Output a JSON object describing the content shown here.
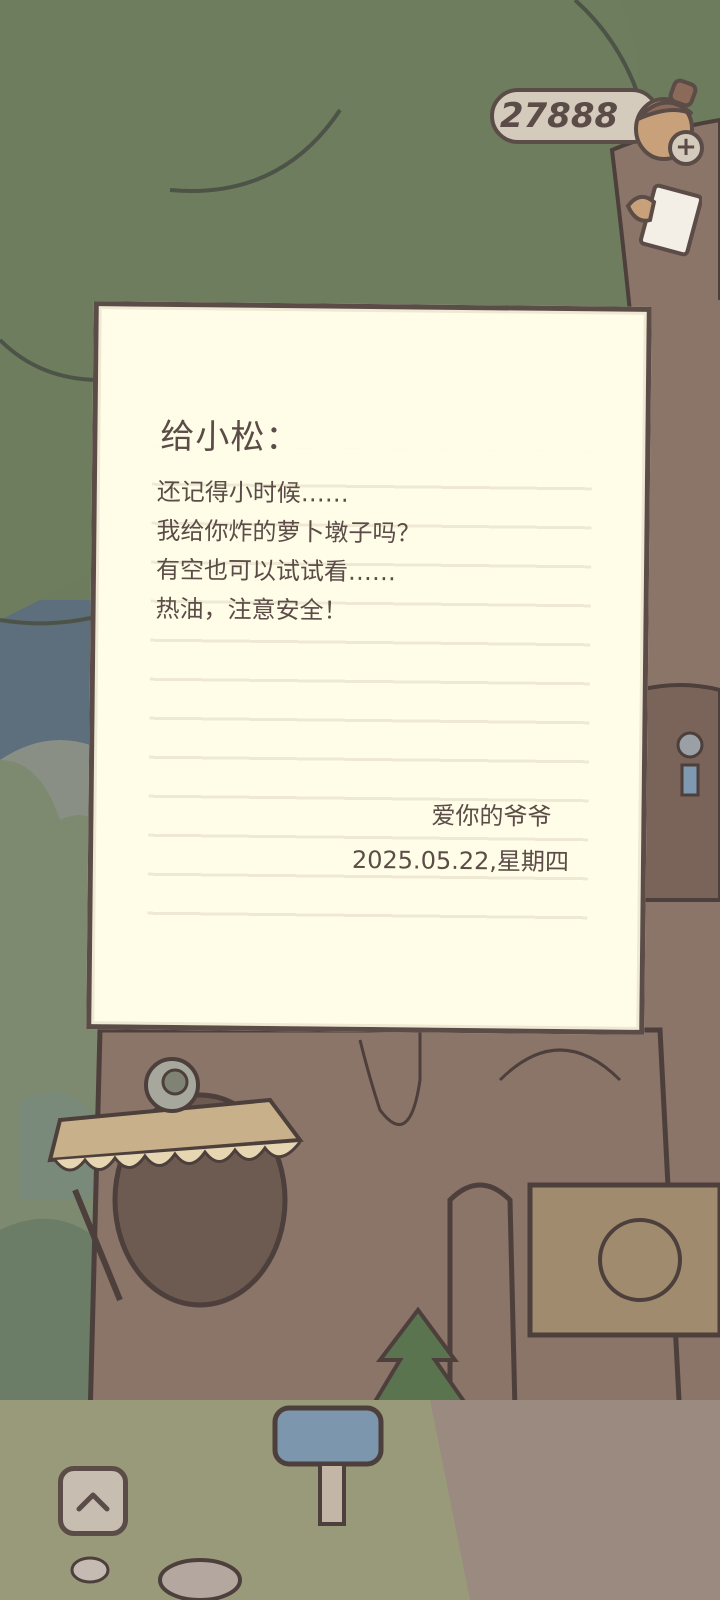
{
  "currency": {
    "amount": "27888",
    "icon": "acorn-icon",
    "add_icon": "plus-icon"
  },
  "letter": {
    "salutation": "给小松：",
    "lines": [
      "还记得小时候……",
      "我给你炸的萝卜墩子吗？",
      "有空也可以试试看……",
      "热油，注意安全！"
    ],
    "signature": "爱你的爷爷",
    "date": "2025.05.22,星期四"
  },
  "controls": {
    "expand_icon": "chevron-up-icon"
  },
  "colors": {
    "outline": "#5b4c47",
    "paper": "#fffde8",
    "foliage": "#6c7c5c",
    "bark": "#8b7468",
    "ground": "#999a7a"
  }
}
